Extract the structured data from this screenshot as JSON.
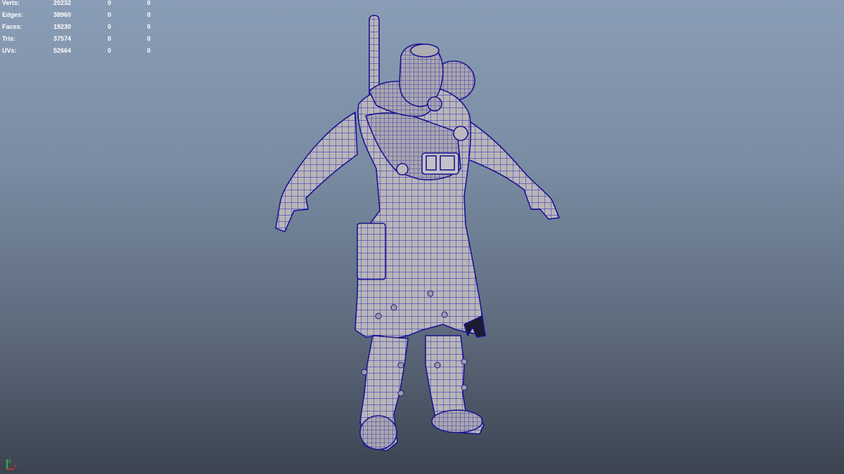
{
  "hud": {
    "rows": [
      {
        "label": "Verts:",
        "total": "20232",
        "selected": "0",
        "highlighted": "0"
      },
      {
        "label": "Edges:",
        "total": "38960",
        "selected": "0",
        "highlighted": "0"
      },
      {
        "label": "Faces:",
        "total": "19230",
        "selected": "0",
        "highlighted": "0"
      },
      {
        "label": "Tris:",
        "total": "37574",
        "selected": "0",
        "highlighted": "0"
      },
      {
        "label": "UVs:",
        "total": "52664",
        "selected": "0",
        "highlighted": "0"
      }
    ]
  },
  "viewport": {
    "model": "character-wireframe",
    "wire_color": "#1f1ab0",
    "shade_color": "#b8b6b8"
  },
  "axis": {
    "x_label": "x",
    "y_label": "y",
    "x_color": "#e23030",
    "y_color": "#30d040"
  }
}
